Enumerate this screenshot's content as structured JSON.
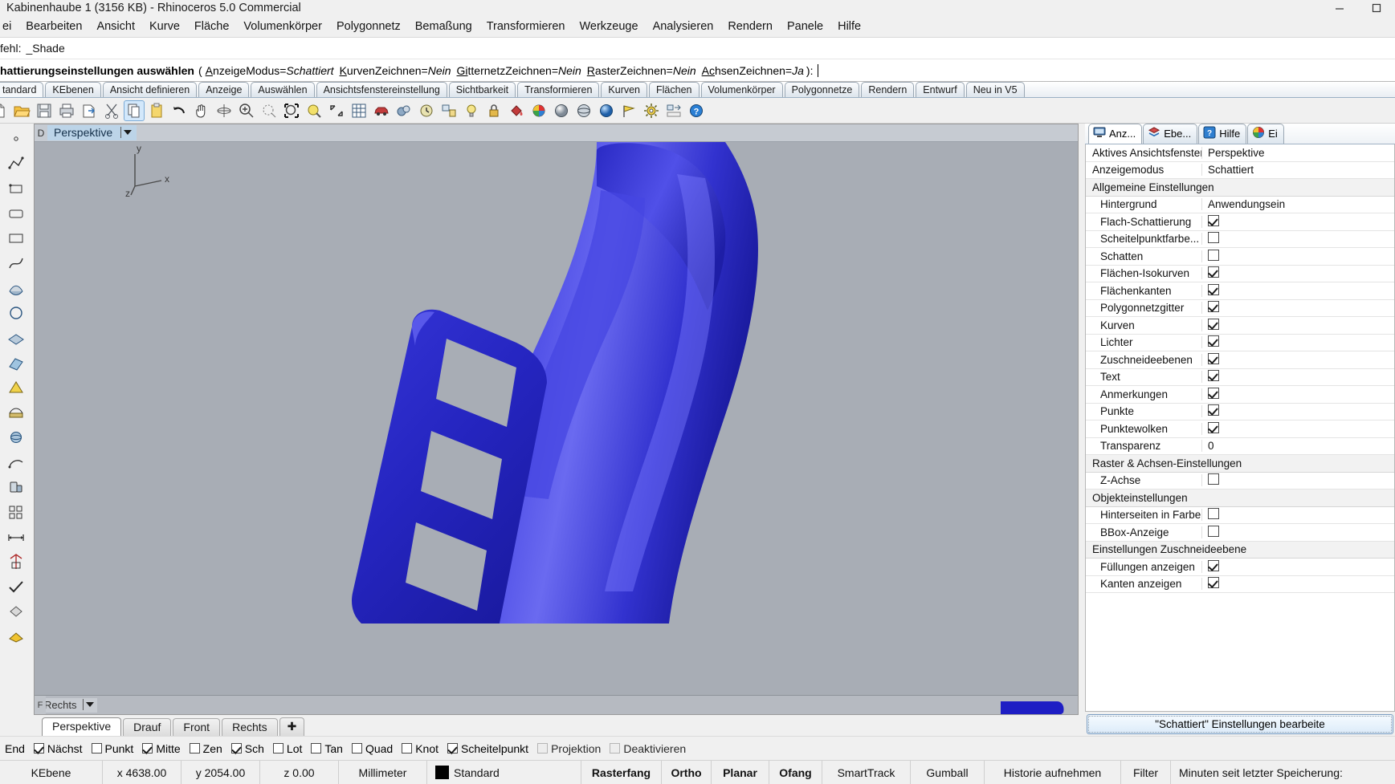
{
  "window": {
    "title": "Kabinenhaube 1 (3156 KB) - Rhinoceros 5.0 Commercial",
    "minimize": "—",
    "maximize": "☐",
    "close": "×"
  },
  "menu": {
    "items": [
      "ei",
      "Bearbeiten",
      "Ansicht",
      "Kurve",
      "Fläche",
      "Volumenkörper",
      "Polygonnetz",
      "Bemaßung",
      "Transformieren",
      "Werkzeuge",
      "Analysieren",
      "Rendern",
      "Panele",
      "Hilfe"
    ]
  },
  "command": {
    "history_label": "fehl:",
    "history_value": "_Shade",
    "prompt_main": "hattierungseinstellungen auswählen",
    "prompt_open": "(",
    "prompt_close": "):",
    "options": [
      {
        "key": "A",
        "name": "nzeigeModus",
        "eq": "=",
        "value": "Schattiert"
      },
      {
        "key": "K",
        "name": "urvenZeichnen",
        "eq": "=",
        "value": "Nein"
      },
      {
        "key": "Gi",
        "name": "tternetzZeichnen",
        "eq": "=",
        "value": "Nein"
      },
      {
        "key": "R",
        "name": "asterZeichnen",
        "eq": "=",
        "value": "Nein"
      },
      {
        "key": "Ac",
        "name": "hsenZeichnen",
        "eq": "=",
        "value": "Ja"
      }
    ]
  },
  "toolbar_tabs": {
    "active": "tandard",
    "items": [
      "tandard",
      "KEbenen",
      "Ansicht definieren",
      "Anzeige",
      "Auswählen",
      "Ansichtsfenstereinstellung",
      "Sichtbarkeit",
      "Transformieren",
      "Kurven",
      "Flächen",
      "Volumenkörper",
      "Polygonnetze",
      "Rendern",
      "Entwurf",
      "Neu in V5"
    ]
  },
  "icon_toolbar": {
    "icons": [
      "new-file-icon",
      "open-folder-icon",
      "save-icon",
      "print-icon",
      "export-icon",
      "cut-scissors-icon",
      "copy-icon",
      "paste-icon",
      "undo-arrow-icon",
      "pan-hand-icon",
      "rotate-view-icon",
      "zoom-in-icon",
      "zoom-dynamic-icon",
      "zoom-window-icon",
      "zoom-selected-icon",
      "zoom-extents-icon",
      "grid-snap-icon",
      "car-render-icon",
      "render-preview-icon",
      "clock-history-icon",
      "properties-icon",
      "light-bulb-icon",
      "lock-icon",
      "paint-bucket-icon",
      "color-wheel-icon",
      "shaded-sphere-icon",
      "ghosted-sphere-icon",
      "rendered-sphere-icon",
      "flag-icon",
      "options-gear-icon",
      "layout-icon",
      "help-icon"
    ],
    "selected_index": 6
  },
  "left_palette": {
    "tools": [
      "point-icon",
      "polyline-icon",
      "rectangle-corner-icon",
      "rectangle-icon",
      "curve-interpolate-icon",
      "circle-icon",
      "surface-loft-icon",
      "surface-patch-icon",
      "arc-icon",
      "extrude-icon",
      "boolean-icon",
      "sphere-icon",
      "pipe-icon",
      "trim-icon",
      "split-icon",
      "fillet-icon",
      "dimension-icon",
      "array-icon",
      "check-icon",
      "material-icon",
      "render-color-icon"
    ]
  },
  "viewport": {
    "main": {
      "label": "Perspektive",
      "background_color": "#a8adb5",
      "model_color": "#2b2bc8",
      "axis_labels": {
        "x": "x",
        "y": "y",
        "z": "z"
      }
    },
    "secondary": {
      "label": "Rechts"
    },
    "left_strip_labels": {
      "top": "D",
      "bottom": "F"
    },
    "tabs": [
      {
        "label": "Perspektive",
        "active": true
      },
      {
        "label": "Drauf",
        "active": false
      },
      {
        "label": "Front",
        "active": false
      },
      {
        "label": "Rechts",
        "active": false
      },
      {
        "label": "✚",
        "active": false,
        "is_plus": true
      }
    ]
  },
  "right_panel": {
    "tabs": [
      {
        "label": "Anz...",
        "icon": "display-monitor-icon",
        "active": true
      },
      {
        "label": "Ebe...",
        "icon": "layers-icon",
        "active": false
      },
      {
        "label": "Hilfe",
        "icon": "help-blue-icon",
        "active": false
      },
      {
        "label": "Ei",
        "icon": "color-wheel-icon",
        "active": false
      }
    ],
    "rows": [
      {
        "type": "kv",
        "label": "Aktives Ansichtsfenster",
        "value": "Perspektive",
        "indent": false
      },
      {
        "type": "kv",
        "label": "Anzeigemodus",
        "value": "Schattiert",
        "indent": false
      },
      {
        "type": "group",
        "label": "Allgemeine Einstellungen"
      },
      {
        "type": "kv",
        "label": "Hintergrund",
        "value": "Anwendungsein",
        "indent": true
      },
      {
        "type": "check",
        "label": "Flach-Schattierung",
        "checked": true,
        "indent": true
      },
      {
        "type": "check",
        "label": "Scheitelpunktfarbe...",
        "checked": false,
        "indent": true
      },
      {
        "type": "check",
        "label": "Schatten",
        "checked": false,
        "indent": true
      },
      {
        "type": "check",
        "label": "Flächen-Isokurven",
        "checked": true,
        "indent": true
      },
      {
        "type": "check",
        "label": "Flächenkanten",
        "checked": true,
        "indent": true
      },
      {
        "type": "check",
        "label": "Polygonnetzgitter",
        "checked": true,
        "indent": true
      },
      {
        "type": "check",
        "label": "Kurven",
        "checked": true,
        "indent": true
      },
      {
        "type": "check",
        "label": "Lichter",
        "checked": true,
        "indent": true
      },
      {
        "type": "check",
        "label": "Zuschneideebenen",
        "checked": true,
        "indent": true
      },
      {
        "type": "check",
        "label": "Text",
        "checked": true,
        "indent": true
      },
      {
        "type": "check",
        "label": "Anmerkungen",
        "checked": true,
        "indent": true
      },
      {
        "type": "check",
        "label": "Punkte",
        "checked": true,
        "indent": true
      },
      {
        "type": "check",
        "label": "Punktewolken",
        "checked": true,
        "indent": true
      },
      {
        "type": "kv",
        "label": "Transparenz",
        "value": "0",
        "indent": true
      },
      {
        "type": "group",
        "label": "Raster & Achsen-Einstellungen"
      },
      {
        "type": "check",
        "label": "Z-Achse",
        "checked": false,
        "indent": true
      },
      {
        "type": "group",
        "label": "Objekteinstellungen"
      },
      {
        "type": "check",
        "label": "Hinterseiten in Farbe",
        "checked": false,
        "indent": true
      },
      {
        "type": "check",
        "label": "BBox-Anzeige",
        "checked": false,
        "indent": true
      },
      {
        "type": "group",
        "label": "Einstellungen Zuschneideebene"
      },
      {
        "type": "check",
        "label": "Füllungen anzeigen",
        "checked": true,
        "indent": true
      },
      {
        "type": "check",
        "label": "Kanten anzeigen",
        "checked": true,
        "indent": true
      }
    ],
    "button_label": "\"Schattiert\" Einstellungen bearbeite"
  },
  "osnap": {
    "items": [
      {
        "label": "End",
        "checked": null,
        "disabled": false,
        "no_box": true
      },
      {
        "label": "Nächst",
        "checked": true,
        "disabled": false
      },
      {
        "label": "Punkt",
        "checked": false,
        "disabled": false
      },
      {
        "label": "Mitte",
        "checked": true,
        "disabled": false
      },
      {
        "label": "Zen",
        "checked": false,
        "disabled": false
      },
      {
        "label": "Sch",
        "checked": true,
        "disabled": false
      },
      {
        "label": "Lot",
        "checked": false,
        "disabled": false
      },
      {
        "label": "Tan",
        "checked": false,
        "disabled": false
      },
      {
        "label": "Quad",
        "checked": false,
        "disabled": false
      },
      {
        "label": "Knot",
        "checked": false,
        "disabled": false
      },
      {
        "label": "Scheitelpunkt",
        "checked": true,
        "disabled": false
      },
      {
        "label": "Projektion",
        "checked": false,
        "disabled": true
      },
      {
        "label": "Deaktivieren",
        "checked": false,
        "disabled": true
      }
    ]
  },
  "statusbar": {
    "cplane": "KEbene",
    "x": "x 4638.00",
    "y": "y 2054.00",
    "z": "z 0.00",
    "units": "Millimeter",
    "layer": "Standard",
    "layer_color": "#000000",
    "toggles": [
      {
        "label": "Rasterfang",
        "bold": true
      },
      {
        "label": "Ortho",
        "bold": true
      },
      {
        "label": "Planar",
        "bold": true
      },
      {
        "label": "Ofang",
        "bold": true
      },
      {
        "label": "SmartTrack",
        "bold": false
      },
      {
        "label": "Gumball",
        "bold": false
      },
      {
        "label": "Historie aufnehmen",
        "bold": false
      },
      {
        "label": "Filter",
        "bold": false
      }
    ],
    "save_note": "Minuten seit letzter Speicherung:"
  }
}
